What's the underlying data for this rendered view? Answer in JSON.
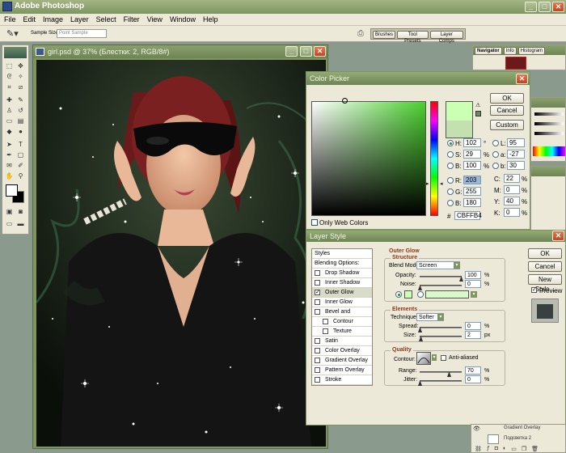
{
  "app": {
    "title": "Adobe Photoshop"
  },
  "menu": [
    "File",
    "Edit",
    "Image",
    "Layer",
    "Select",
    "Filter",
    "View",
    "Window",
    "Help"
  ],
  "options": {
    "sample_size_label": "Sample Size:",
    "sample_size_value": "Point Sample"
  },
  "palette_well": {
    "tabs": [
      "Brushes",
      "Tool Presets",
      "Layer Comps"
    ]
  },
  "navigator": {
    "tabs": [
      "Navigator",
      "Info",
      "Histogram"
    ]
  },
  "document": {
    "title": "girl.psd @ 37% (Блестки: 2, RGB/8#)"
  },
  "color_picker": {
    "title": "Color Picker",
    "ok": "OK",
    "cancel": "Cancel",
    "custom": "Custom",
    "only_web_colors": "Only Web Colors",
    "hex_label": "#",
    "hex_value": "CBFFB4",
    "new_color": "#cbffb4",
    "old_color": "#c4e0b0",
    "hsb": [
      {
        "label": "H:",
        "value": "102",
        "unit": "°"
      },
      {
        "label": "S:",
        "value": "29",
        "unit": "%"
      },
      {
        "label": "B:",
        "value": "100",
        "unit": "%"
      }
    ],
    "rgb": [
      {
        "label": "R:",
        "value": "203"
      },
      {
        "label": "G:",
        "value": "255"
      },
      {
        "label": "B:",
        "value": "180"
      }
    ],
    "lab": [
      {
        "label": "L:",
        "value": "95"
      },
      {
        "label": "a:",
        "value": "-27"
      },
      {
        "label": "b:",
        "value": "30"
      }
    ],
    "cmyk": [
      {
        "label": "C:",
        "value": "22",
        "unit": "%"
      },
      {
        "label": "M:",
        "value": "0",
        "unit": "%"
      },
      {
        "label": "Y:",
        "value": "40",
        "unit": "%"
      },
      {
        "label": "K:",
        "value": "0",
        "unit": "%"
      }
    ]
  },
  "layer_style": {
    "title": "Layer Style",
    "ok": "OK",
    "cancel": "Cancel",
    "new_style": "New Style...",
    "preview": "Preview",
    "styles": [
      {
        "label": "Styles",
        "checkbox": false,
        "selected": false
      },
      {
        "label": "Blending Options: Default",
        "checkbox": false,
        "selected": false
      },
      {
        "label": "Drop Shadow",
        "checkbox": true,
        "selected": false
      },
      {
        "label": "Inner Shadow",
        "checkbox": true,
        "selected": false
      },
      {
        "label": "Outer Glow",
        "checkbox": true,
        "selected": true
      },
      {
        "label": "Inner Glow",
        "checkbox": true,
        "selected": false
      },
      {
        "label": "Bevel and Emboss",
        "checkbox": true,
        "selected": false
      },
      {
        "label": "Contour",
        "checkbox": true,
        "selected": false,
        "indent": true
      },
      {
        "label": "Texture",
        "checkbox": true,
        "selected": false,
        "indent": true
      },
      {
        "label": "Satin",
        "checkbox": true,
        "selected": false
      },
      {
        "label": "Color Overlay",
        "checkbox": true,
        "selected": false
      },
      {
        "label": "Gradient Overlay",
        "checkbox": true,
        "selected": false
      },
      {
        "label": "Pattern Overlay",
        "checkbox": true,
        "selected": false
      },
      {
        "label": "Stroke",
        "checkbox": true,
        "selected": false
      }
    ],
    "outer_glow": {
      "heading": "Outer Glow",
      "structure": "Structure",
      "blend_mode_label": "Blend Mode:",
      "blend_mode_value": "Screen",
      "opacity_label": "Opacity:",
      "opacity_value": "100",
      "opacity_unit": "%",
      "noise_label": "Noise:",
      "noise_value": "0",
      "noise_unit": "%",
      "elements": "Elements",
      "technique_label": "Technique:",
      "technique_value": "Softer",
      "spread_label": "Spread:",
      "spread_value": "0",
      "spread_unit": "%",
      "size_label": "Size:",
      "size_value": "2",
      "size_unit": "px",
      "quality": "Quality",
      "contour_label": "Contour:",
      "anti_aliased": "Anti-aliased",
      "range_label": "Range:",
      "range_value": "70",
      "range_unit": "%",
      "jitter_label": "Jitter:",
      "jitter_value": "0",
      "jitter_unit": "%"
    }
  },
  "layers": {
    "rows": [
      "Gradient Overlay",
      "Подсветка 2"
    ]
  }
}
